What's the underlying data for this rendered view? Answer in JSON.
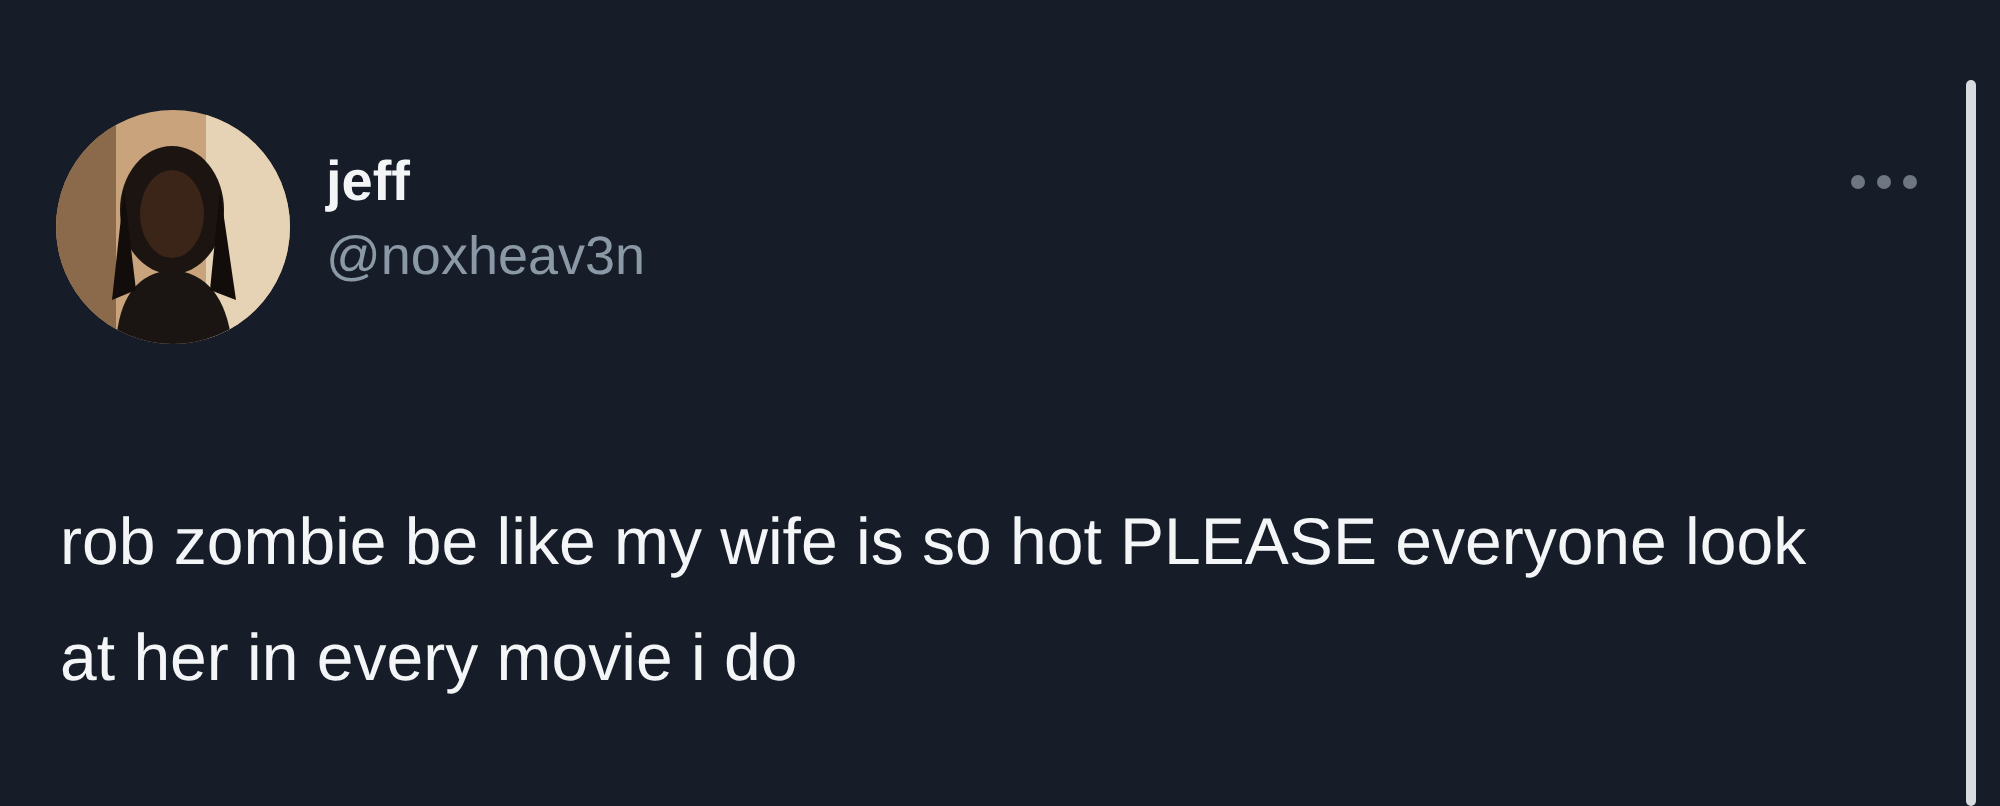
{
  "tweet": {
    "author": {
      "name": "jeff",
      "handle": "@noxheav3n"
    },
    "text": "rob zombie be like my wife is so hot PLEASE everyone look at her in every movie i do"
  }
}
